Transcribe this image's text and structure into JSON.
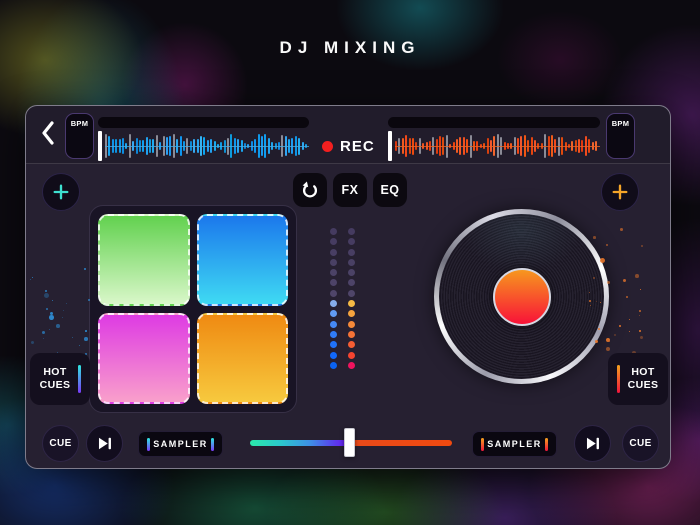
{
  "title": "DJ MIXING",
  "header": {
    "rec_label": "REC",
    "left_deck": {
      "bpm_label": "BPM"
    },
    "right_deck": {
      "bpm_label": "BPM"
    }
  },
  "toolbar": {
    "fx_label": "FX",
    "eq_label": "EQ"
  },
  "icons": {
    "back": "chevron-left",
    "add_left": "plus",
    "add_right": "plus",
    "loop": "loop-arrow",
    "skip": "skip-next",
    "record": "record-dot"
  },
  "pads": [
    {
      "name": "green-pad",
      "color_from": "#62D14F",
      "color_to": "#D9F7C9"
    },
    {
      "name": "blue-pad",
      "color_from": "#1B78EC",
      "color_to": "#3FDAF3"
    },
    {
      "name": "magenta-pad",
      "color_from": "#DE3BE3",
      "color_to": "#F9A0CB"
    },
    {
      "name": "orange-pad",
      "color_from": "#EF8A12",
      "color_to": "#F7C93E"
    }
  ],
  "meters": {
    "left": [
      "#453B60",
      "#463C61",
      "#483E63",
      "#494064",
      "#4B4266",
      "#4D4368",
      "#4F4569",
      "#86ADEB",
      "#619BF3",
      "#4589F6",
      "#307CF8",
      "#2072FA",
      "#1168FB",
      "#0A62F1"
    ],
    "right": [
      "#453B60",
      "#463C61",
      "#483E63",
      "#494064",
      "#4B4266",
      "#4D4368",
      "#4F4569",
      "#F6BA45",
      "#F5A33E",
      "#F68939",
      "#F67336",
      "#F65D33",
      "#F64430",
      "#F0135E"
    ]
  },
  "hot_cues": {
    "label": "HOT CUES"
  },
  "transport": {
    "cue_label": "CUE",
    "sampler_label": "SAMPLER",
    "crossfader_position_pct": 49.5
  },
  "colors": {
    "rec_red": "#F31F1F",
    "accent_teal_plus": "#3EE0D0",
    "accent_orange_plus": "#F5A528",
    "bar_teal_top": "#2EE8E0",
    "bar_teal_bottom": "#7A3AF8",
    "bar_fire_top": "#F5A21E",
    "bar_fire_bottom": "#F0143C",
    "vinyl_label_top": "#F7971E",
    "vinyl_label_bottom": "#F81238",
    "crossfader_left": [
      "#2BE9AA",
      "#2BC9CC",
      "#3E8EE6",
      "#5A3BEE",
      "#6B14EC"
    ],
    "crossfader_right": [
      "#E94A1A",
      "#F04A10"
    ],
    "waveform_left_hue": 199,
    "waveform_right_hue": 12,
    "splatter_left": "#2E9AE8",
    "splatter_right": "#E8762A"
  }
}
